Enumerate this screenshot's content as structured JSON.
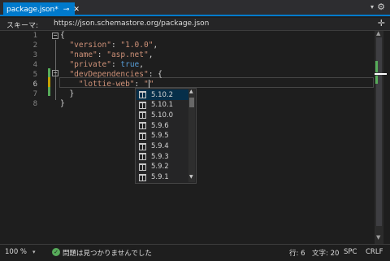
{
  "tab": {
    "title": "package.json*",
    "pin_glyph": "⊸",
    "close_glyph": "✕"
  },
  "window": {
    "dropdown_glyph": "▾",
    "settings_glyph": "⚙"
  },
  "schema": {
    "label": "スキーマ:",
    "url": "https://json.schemastore.org/package.json",
    "expand_glyph": "✛"
  },
  "editor": {
    "line_numbers": [
      "1",
      "2",
      "3",
      "4",
      "5",
      "6",
      "7",
      "8"
    ],
    "current_line": "6",
    "lines": [
      [
        {
          "t": "{",
          "c": "brace"
        }
      ],
      [
        {
          "t": "  ",
          "c": "punc"
        },
        {
          "t": "\"version\"",
          "c": "keyname"
        },
        {
          "t": ": ",
          "c": "punc"
        },
        {
          "t": "\"1.0.0\"",
          "c": "str"
        },
        {
          "t": ",",
          "c": "punc"
        }
      ],
      [
        {
          "t": "  ",
          "c": "punc"
        },
        {
          "t": "\"name\"",
          "c": "keyname"
        },
        {
          "t": ": ",
          "c": "punc"
        },
        {
          "t": "\"asp.net\"",
          "c": "str"
        },
        {
          "t": ",",
          "c": "punc"
        }
      ],
      [
        {
          "t": "  ",
          "c": "punc"
        },
        {
          "t": "\"private\"",
          "c": "keyname"
        },
        {
          "t": ": ",
          "c": "punc"
        },
        {
          "t": "true",
          "c": "bool"
        },
        {
          "t": ",",
          "c": "punc"
        }
      ],
      [
        {
          "t": "  ",
          "c": "punc"
        },
        {
          "t": "\"devDependencies\"",
          "c": "keyname"
        },
        {
          "t": ": {",
          "c": "punc"
        }
      ],
      [
        {
          "t": "    ",
          "c": "punc"
        },
        {
          "t": "\"lottie-web\"",
          "c": "keyname"
        },
        {
          "t": ": ",
          "c": "punc"
        },
        {
          "t": "\"",
          "c": "str"
        },
        {
          "t": "|",
          "c": "caret"
        },
        {
          "t": "\"",
          "c": "str"
        }
      ],
      [
        {
          "t": "  }",
          "c": "punc"
        }
      ],
      [
        {
          "t": "}",
          "c": "brace"
        }
      ]
    ]
  },
  "completion": {
    "items": [
      "5.10.2",
      "5.10.1",
      "5.10.0",
      "5.9.6",
      "5.9.5",
      "5.9.4",
      "5.9.3",
      "5.9.2",
      "5.9.1"
    ],
    "selected_index": 0,
    "item_icon": "package-icon"
  },
  "status": {
    "zoom": "100 %",
    "zoom_dropdown_glyph": "▾",
    "issues_icon_glyph": "✓",
    "issues": "問題は見つかりませんでした",
    "line": "行: 6",
    "char": "文字: 20",
    "whitespace": "SPC",
    "eol": "CRLF"
  },
  "colors": {
    "accent": "#007acc",
    "change_saved": "#57ab5a",
    "change_unsaved": "#c6a100",
    "json_key": "#ce9178",
    "json_string": "#ce9178",
    "json_bool": "#569cd6"
  }
}
